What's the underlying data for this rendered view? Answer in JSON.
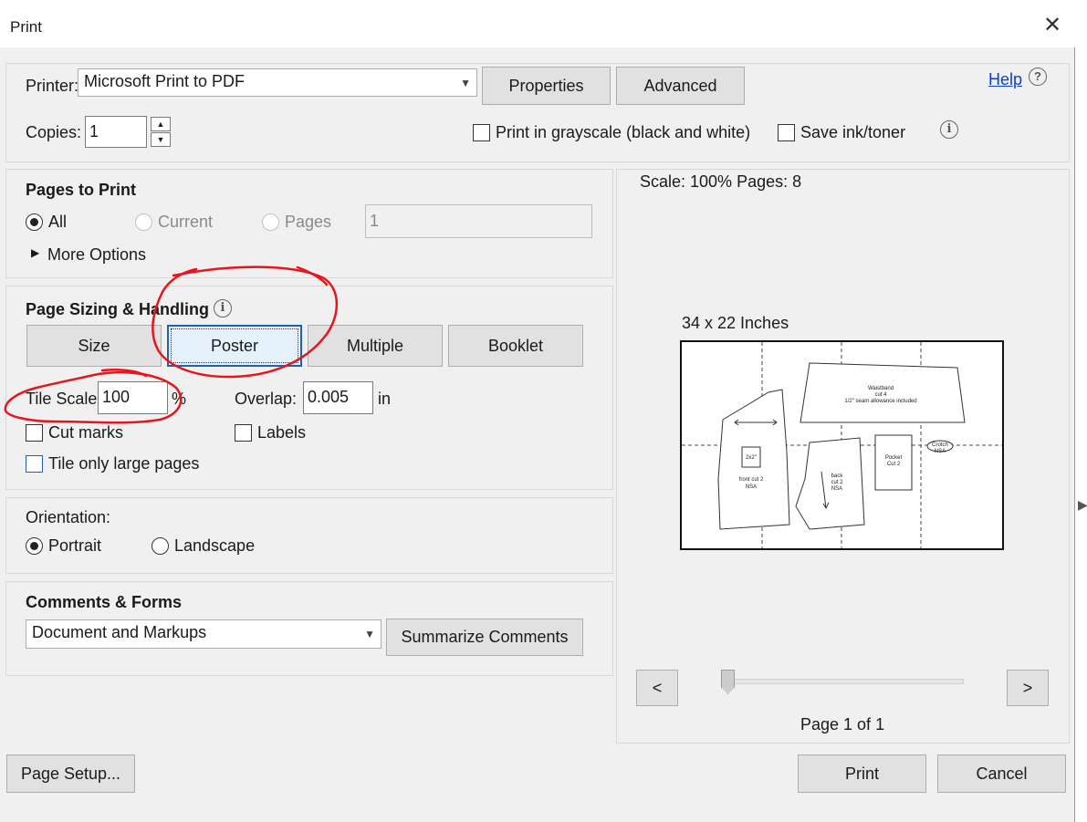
{
  "window": {
    "title": "Print"
  },
  "header": {
    "printer_label": "Printer:",
    "printer_value": "Microsoft Print to PDF",
    "properties_label": "Properties",
    "advanced_label": "Advanced",
    "help_label": "Help",
    "copies_label": "Copies:",
    "copies_value": "1",
    "grayscale_label": "Print in grayscale (black and white)",
    "save_ink_label": "Save ink/toner"
  },
  "pages_to_print": {
    "heading": "Pages to Print",
    "all_label": "All",
    "current_label": "Current",
    "pages_label": "Pages",
    "pages_value": "1",
    "more_options_label": "More Options"
  },
  "page_sizing": {
    "heading": "Page Sizing & Handling",
    "tabs": [
      {
        "label": "Size"
      },
      {
        "label": "Poster"
      },
      {
        "label": "Multiple"
      },
      {
        "label": "Booklet"
      }
    ],
    "tile_scale_label": "Tile Scale:",
    "tile_scale_value": "100",
    "percent": "%",
    "overlap_label": "Overlap:",
    "overlap_value": "0.005",
    "overlap_unit": "in",
    "cut_marks_label": "Cut marks",
    "labels_label": "Labels",
    "tile_large_label": "Tile only large pages"
  },
  "orientation": {
    "heading": "Orientation:",
    "portrait_label": "Portrait",
    "landscape_label": "Landscape"
  },
  "comments_forms": {
    "heading": "Comments & Forms",
    "select_value": "Document and Markups",
    "summarize_label": "Summarize Comments"
  },
  "preview": {
    "scale_text": "Scale: 100% Pages: 8",
    "size_text": "34 x 22 Inches",
    "prev_label": "<",
    "next_label": ">",
    "page_text": "Page 1 of 1",
    "pieces": {
      "waistband_line1": "Waistband",
      "waistband_line2": "cut 4",
      "waistband_line3": "1/2\" seam allowance included",
      "front_patch": "2x2\"",
      "front_line1": "front cut 2",
      "front_line2": "NSA",
      "back_line1": "back",
      "back_line2": "cut 2",
      "back_line3": "NSA",
      "pocket_line1": "Pocket",
      "pocket_line2": "Cut 2",
      "crotch_line1": "Crotch",
      "crotch_line2": "NSA"
    }
  },
  "footer": {
    "page_setup_label": "Page Setup...",
    "print_label": "Print",
    "cancel_label": "Cancel"
  },
  "colors": {
    "annotation_red": "#e8141c",
    "link_blue": "#0b3dd8",
    "poster_focus": "#1e62b8"
  }
}
